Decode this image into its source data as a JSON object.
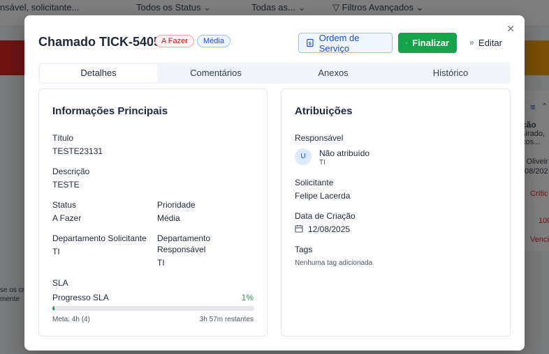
{
  "background": {
    "search_text": "nsável, solicitante...",
    "status_filter": "Todos os Status",
    "second_filter": "Todas as...",
    "advanced_filters": "Filtros Avançados",
    "right_col_title": "ção",
    "right_col_sub1": "sirado,",
    "right_col_sub2": "ços...",
    "right_name": "s Oliveir",
    "right_date": "08/202",
    "right_priority": "Crític",
    "right_progress": "100",
    "right_overdue": "Venci",
    "left_line1": "se os cr",
    "left_line2": "mente"
  },
  "modal": {
    "title": "Chamado TICK-5405",
    "status_badge": "A Fazer",
    "priority_badge": "Média",
    "close_symbol": "✕",
    "buttons": {
      "service_order": "Ordem de Serviço",
      "finalize": "Finalizar",
      "edit": "Editar"
    },
    "tabs": [
      "Detalhes",
      "Comentários",
      "Anexos",
      "Histórico"
    ],
    "active_tab": "Detalhes",
    "main_info": {
      "heading": "Informações Principais",
      "title_label": "Título",
      "title_value": "TESTE23131",
      "description_label": "Descrição",
      "description_value": "TESTE",
      "status_label": "Status",
      "status_value": "A Fazer",
      "priority_label": "Prioridade",
      "priority_value": "Média",
      "req_dept_label": "Departamento Solicitante",
      "req_dept_value": "TI",
      "resp_dept_label_1": "Departamento",
      "resp_dept_label_2": "Responsável",
      "resp_dept_value": "TI",
      "sla_heading": "SLA",
      "sla_progress_label": "Progresso SLA",
      "sla_progress_text": "1%",
      "sla_progress_fraction": 0.01,
      "sla_goal": "Meta: 4h (4)",
      "sla_remaining": "3h 57m restantes"
    },
    "assignments": {
      "heading": "Atribuições",
      "responsible_label": "Responsável",
      "avatar_initial": "U",
      "responsible_name": "Não atribuído",
      "responsible_dept": "TI",
      "requester_label": "Solicitante",
      "requester_value": "Felipe Lacerda",
      "created_label": "Data de Criação",
      "created_value": "12/08/2025",
      "tags_label": "Tags",
      "tags_value": "Nenhuma tag adicionada"
    }
  },
  "colors": {
    "accent_blue": "#1d4ed8",
    "success_green": "#16a34a",
    "status_red": "#b91c1c"
  }
}
